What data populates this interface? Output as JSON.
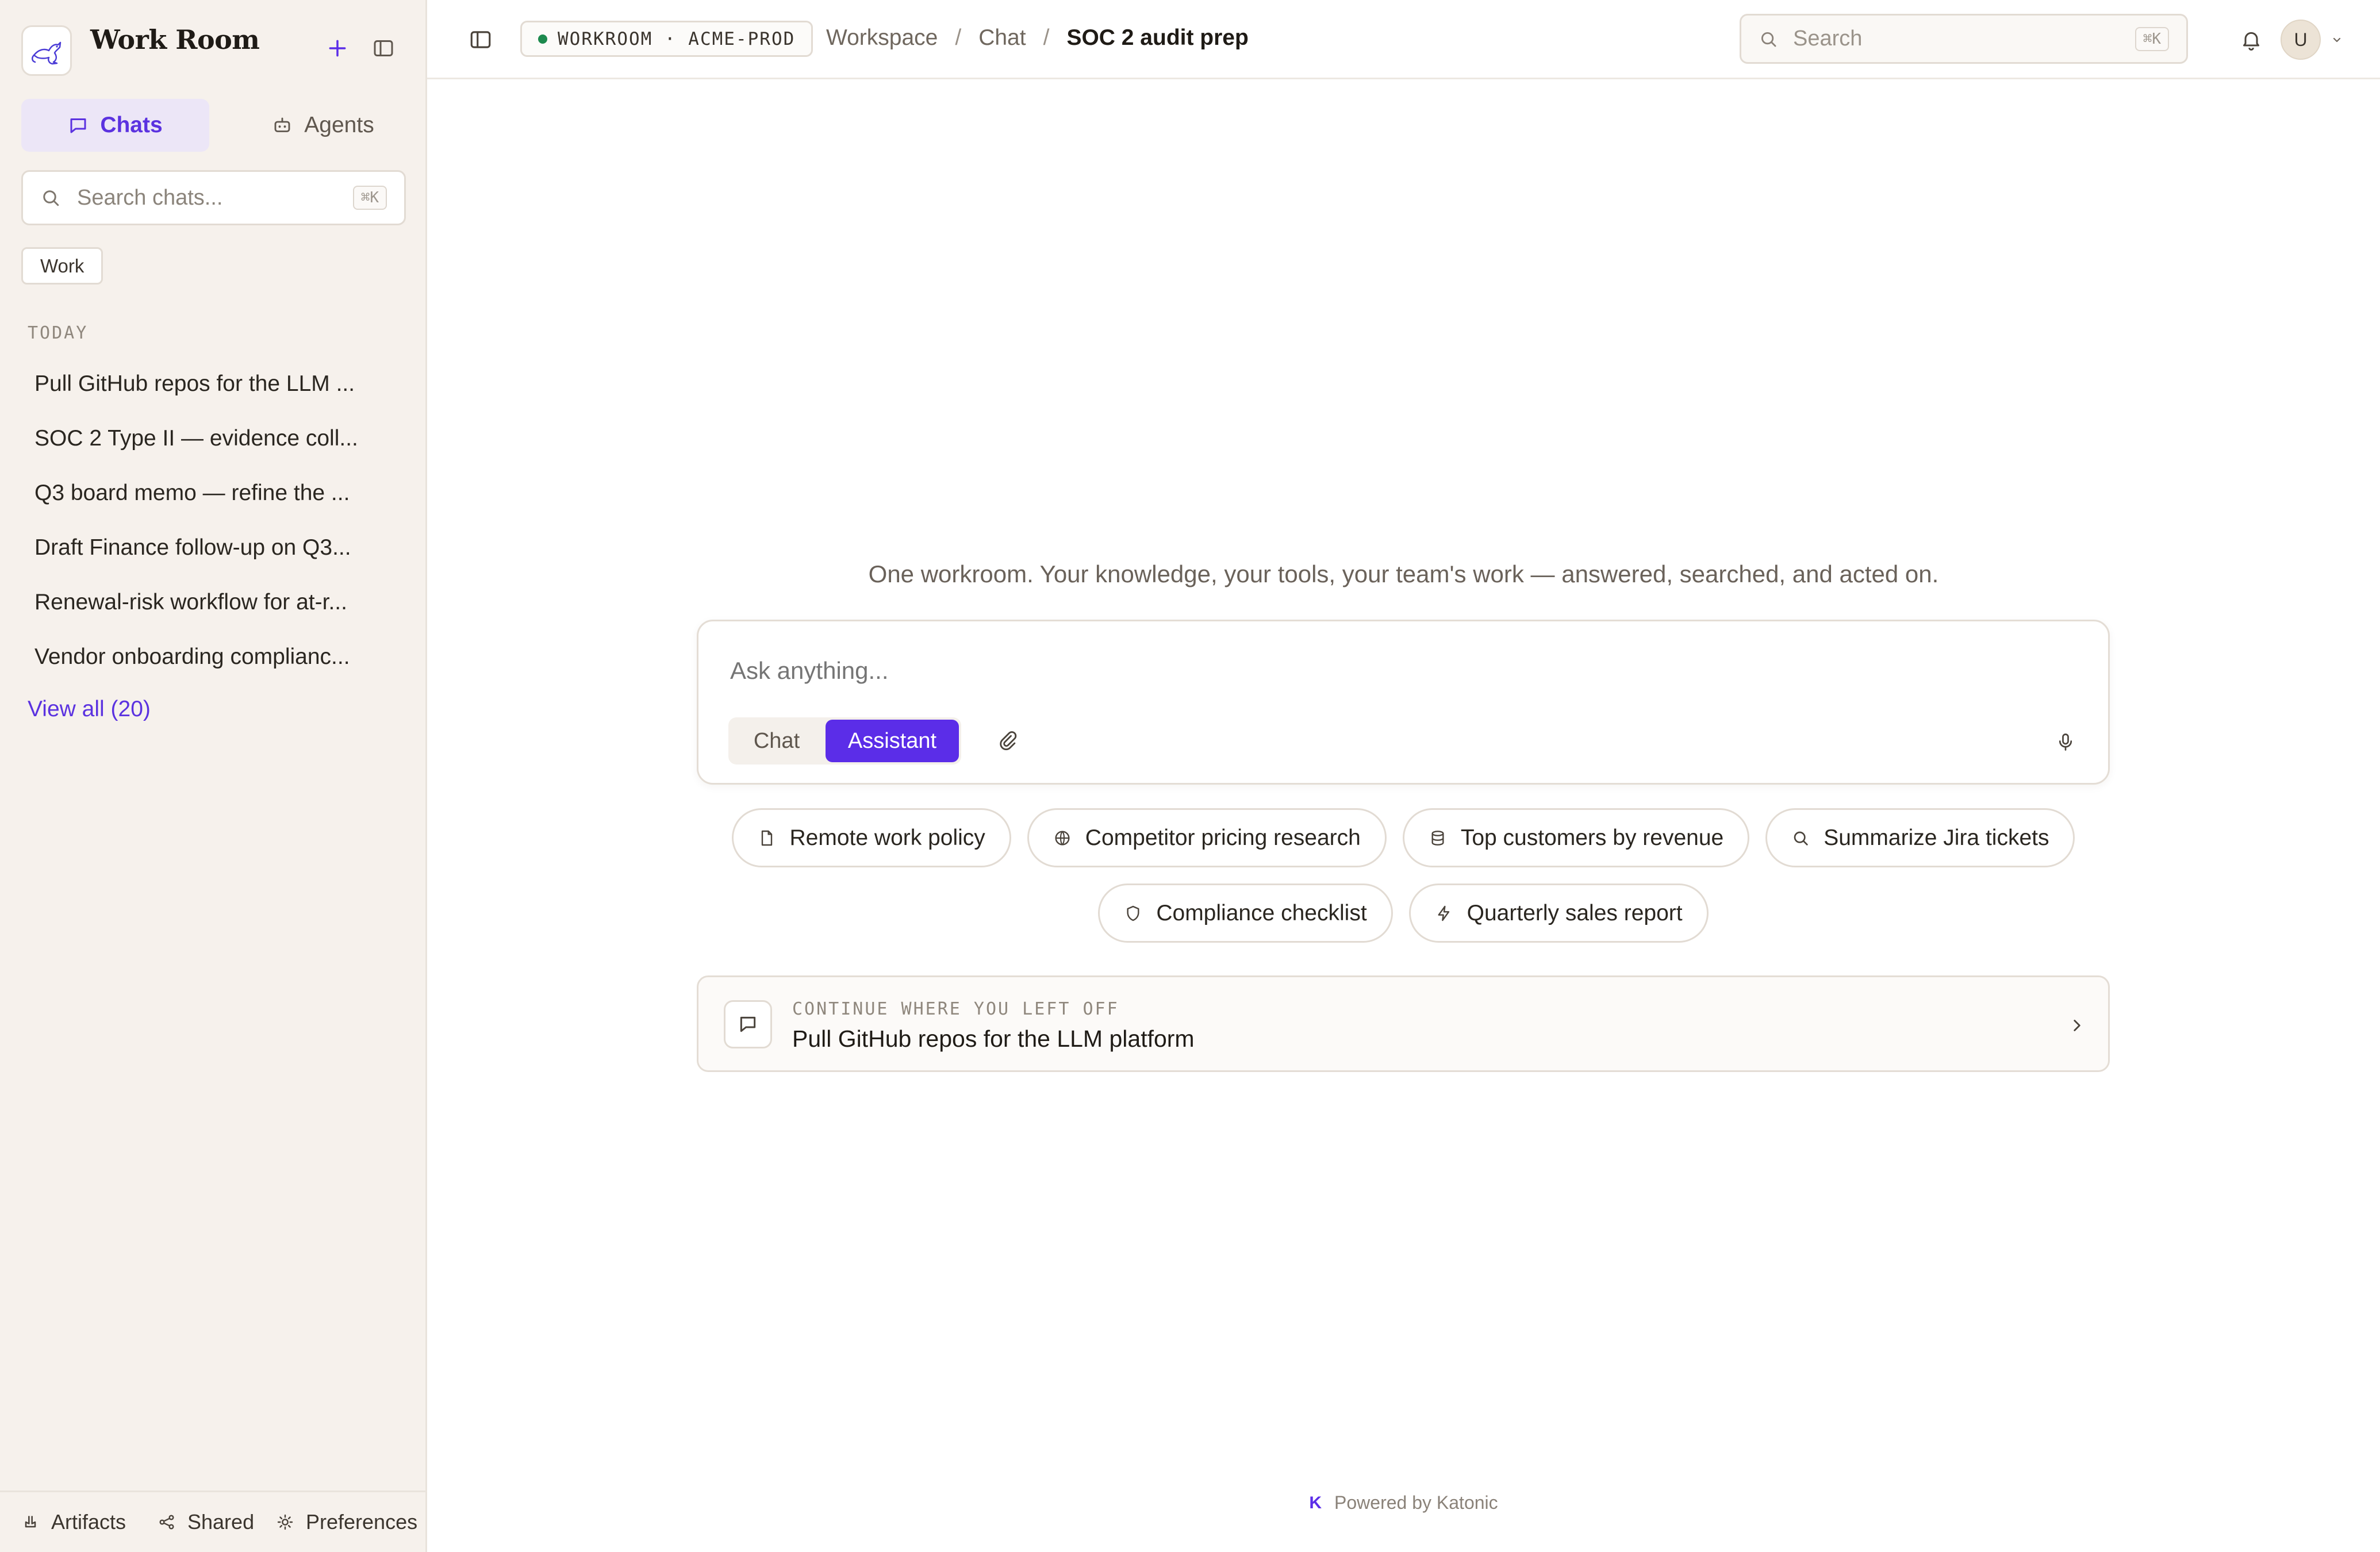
{
  "app": {
    "title": "Work Room"
  },
  "sidebar": {
    "tabs": [
      {
        "label": "Chats",
        "icon": "chat-bubble-icon",
        "active": true
      },
      {
        "label": "Agents",
        "icon": "bot-icon",
        "active": false
      }
    ],
    "search": {
      "placeholder": "Search chats...",
      "shortcut": "⌘K"
    },
    "filter_chip": "Work",
    "section_label": "TODAY",
    "chats": [
      "Pull GitHub repos for the LLM ...",
      "SOC 2 Type II — evidence coll...",
      "Q3 board memo — refine the ...",
      "Draft Finance follow-up on Q3...",
      "Renewal-risk workflow for at-r...",
      "Vendor onboarding complianc..."
    ],
    "view_all": "View all (20)",
    "footer": [
      {
        "label": "Artifacts",
        "icon": "artifact-icon"
      },
      {
        "label": "Shared",
        "icon": "share-icon"
      },
      {
        "label": "Preferences",
        "icon": "sun-gear-icon"
      }
    ]
  },
  "topbar": {
    "env_label": "WORKROOM · ACME-PROD",
    "env_status_color": "#1d8a4e",
    "breadcrumb": [
      "Workspace",
      "Chat",
      "SOC 2 audit prep"
    ],
    "search": {
      "placeholder": "Search",
      "shortcut": "⌘K"
    },
    "avatar_initial": "U"
  },
  "main": {
    "tagline": "One workroom. Your knowledge, your tools, your team's work — answered, searched, and acted on.",
    "composer": {
      "placeholder": "Ask anything...",
      "modes": [
        "Chat",
        "Assistant"
      ],
      "active_mode": "Assistant"
    },
    "suggestions_row1": [
      {
        "label": "Remote work policy",
        "icon": "document-icon"
      },
      {
        "label": "Competitor pricing research",
        "icon": "globe-icon"
      },
      {
        "label": "Top customers by revenue",
        "icon": "database-icon"
      },
      {
        "label": "Summarize Jira tickets",
        "icon": "search-icon"
      }
    ],
    "suggestions_row2": [
      {
        "label": "Compliance checklist",
        "icon": "shield-icon"
      },
      {
        "label": "Quarterly sales report",
        "icon": "lightning-icon"
      }
    ],
    "continue": {
      "kicker": "CONTINUE WHERE YOU LEFT OFF",
      "title": "Pull GitHub repos for the LLM platform"
    },
    "footer": {
      "logo_letter": "K",
      "text": "Powered by Katonic"
    }
  },
  "colors": {
    "accent": "#5b2de8",
    "sidebar_bg": "#f6f1ec",
    "active_tab_bg": "#ece6f7"
  }
}
